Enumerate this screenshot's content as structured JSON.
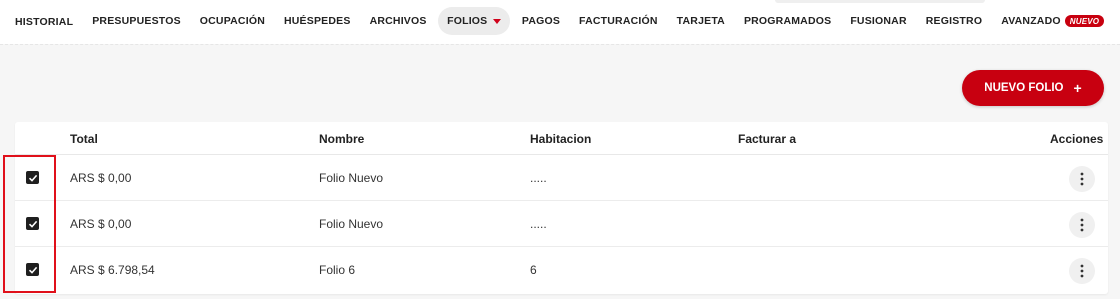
{
  "nav": {
    "items": [
      {
        "label": "HISTORIAL"
      },
      {
        "label": "PRESUPUESTOS"
      },
      {
        "label": "OCUPACIÓN"
      },
      {
        "label": "HUÉSPEDES"
      },
      {
        "label": "ARCHIVOS"
      },
      {
        "label": "FOLIOS",
        "active": true,
        "icon": "caret-down-icon"
      },
      {
        "label": "PAGOS"
      },
      {
        "label": "FACTURACIÓN"
      },
      {
        "label": "TARJETA"
      },
      {
        "label": "PROGRAMADOS"
      },
      {
        "label": "FUSIONAR"
      },
      {
        "label": "REGISTRO"
      },
      {
        "label": "AVANZADO",
        "badge": "NUEVO"
      }
    ]
  },
  "actions": {
    "new_folio_label": "NUEVO FOLIO",
    "new_folio_icon": "plus-icon",
    "accent_color": "#c80010"
  },
  "table": {
    "headers": {
      "total": "Total",
      "nombre": "Nombre",
      "habitacion": "Habitacion",
      "facturar_a": "Facturar a",
      "acciones": "Acciones"
    },
    "rows": [
      {
        "checked": true,
        "total": "ARS $ 0,00",
        "nombre": "Folio Nuevo",
        "habitacion": ".....",
        "facturar_a": ""
      },
      {
        "checked": true,
        "total": "ARS $ 0,00",
        "nombre": "Folio Nuevo",
        "habitacion": ".....",
        "facturar_a": ""
      },
      {
        "checked": true,
        "total": "ARS $ 6.798,54",
        "nombre": "Folio 6",
        "habitacion": "6",
        "facturar_a": ""
      }
    ],
    "row_action_icon": "kebab-menu-icon"
  },
  "annotation": {
    "highlight_color": "#e0101a"
  }
}
